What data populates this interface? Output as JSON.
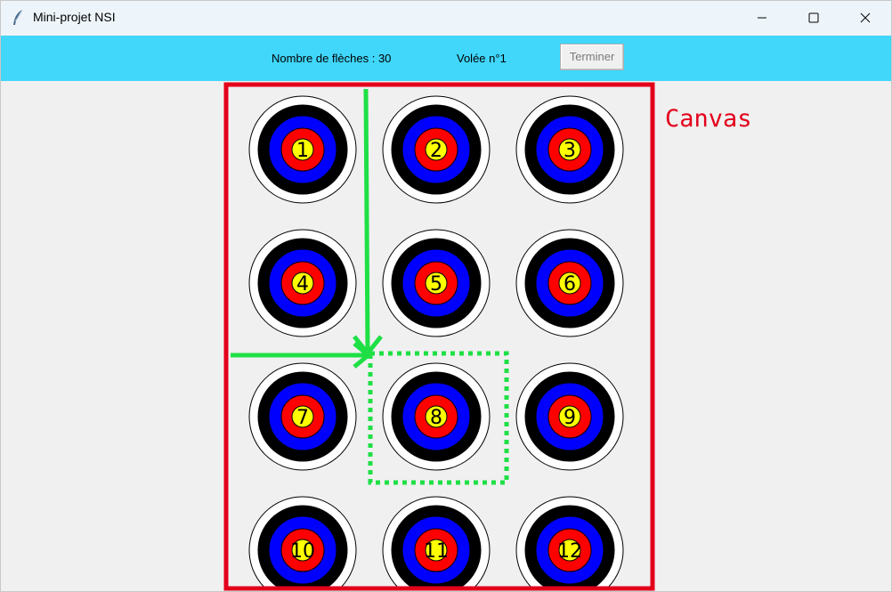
{
  "window": {
    "title": "Mini-projet NSI",
    "controls": [
      "minimize",
      "maximize",
      "close"
    ]
  },
  "toolbar": {
    "arrow_count_label": "Nombre de flèches : 30",
    "volley_label": "Volée n°1",
    "finish_button": "Terminer",
    "background": "#40d7fb"
  },
  "canvas": {
    "annotation_label": "Canvas",
    "targets": [
      "1",
      "2",
      "3",
      "4",
      "5",
      "6",
      "7",
      "8",
      "9",
      "10",
      "11",
      "12"
    ],
    "highlighted_target": "8",
    "ring_colors": [
      "#ffffff",
      "#000000",
      "#0000ff",
      "#ff0000",
      "#ffff00"
    ]
  },
  "annotation_colors": {
    "canvas_frame": "#e3001b",
    "highlight": "#1ee045"
  }
}
